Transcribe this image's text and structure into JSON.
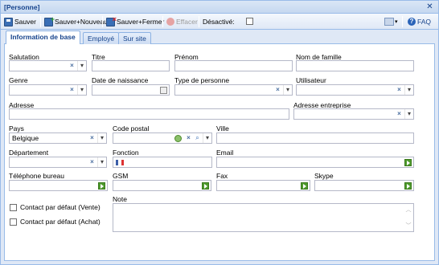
{
  "window": {
    "title": "[Personne]"
  },
  "toolbar": {
    "save_label": "Sauver",
    "save_new_label": "Sauver+Nouveau",
    "save_close_label": "Sauver+Fermer",
    "delete_label": "Effacer",
    "disabled_label": "Désactivé:",
    "disabled_checked": false,
    "faq_label": "FAQ"
  },
  "tabs": [
    {
      "label": "Information de base",
      "active": true
    },
    {
      "label": "Employé",
      "active": false
    },
    {
      "label": "Sur site",
      "active": false
    }
  ],
  "form": {
    "salutation": {
      "label": "Salutation",
      "value": ""
    },
    "titre": {
      "label": "Titre",
      "value": ""
    },
    "prenom": {
      "label": "Prénom",
      "value": ""
    },
    "nom_famille": {
      "label": "Nom de famille",
      "value": ""
    },
    "genre": {
      "label": "Genre",
      "value": ""
    },
    "date_naissance": {
      "label": "Date de naissance",
      "value": ""
    },
    "type_personne": {
      "label": "Type de personne",
      "value": ""
    },
    "utilisateur": {
      "label": "Utilisateur",
      "value": ""
    },
    "adresse": {
      "label": "Adresse",
      "value": ""
    },
    "adresse_entreprise": {
      "label": "Adresse entreprise",
      "value": ""
    },
    "pays": {
      "label": "Pays",
      "value": "Belgique"
    },
    "code_postal": {
      "label": "Code postal",
      "value": ""
    },
    "ville": {
      "label": "Ville",
      "value": ""
    },
    "departement": {
      "label": "Département",
      "value": ""
    },
    "fonction": {
      "label": "Fonction",
      "value": ""
    },
    "email": {
      "label": "Email",
      "value": ""
    },
    "telephone_bureau": {
      "label": "Téléphone bureau",
      "value": ""
    },
    "gsm": {
      "label": "GSM",
      "value": ""
    },
    "fax": {
      "label": "Fax",
      "value": ""
    },
    "skype": {
      "label": "Skype",
      "value": ""
    },
    "contact_vente": {
      "label": "Contact par défaut (Vente)",
      "checked": false
    },
    "contact_achat": {
      "label": "Contact par défaut (Achat)",
      "checked": false
    },
    "note": {
      "label": "Note",
      "value": ""
    }
  },
  "colors": {
    "frame_border": "#99bbe8",
    "title_text": "#15428b",
    "go_button": "#4e9a2c"
  }
}
